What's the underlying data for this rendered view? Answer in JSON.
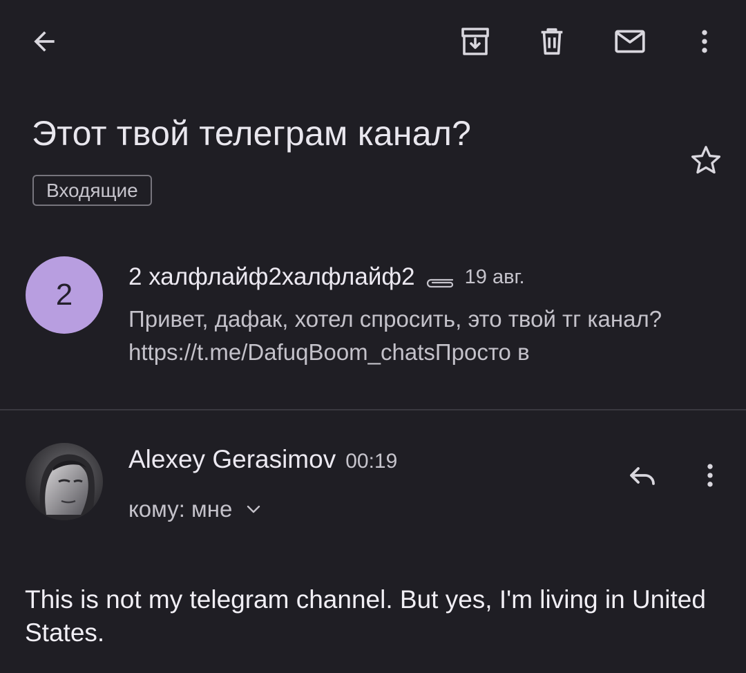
{
  "toolbar": {
    "back": "back-arrow-icon",
    "archive": "archive-icon",
    "delete": "trash-icon",
    "mark_unread": "mail-icon",
    "more": "more-vert-icon"
  },
  "subject": "Этот твой телеграм канал?",
  "label": "Входящие",
  "colors": {
    "background": "#1f1e24",
    "avatar": "#b89ee0",
    "text": "#e6e4ea",
    "muted": "#c4c2ca"
  },
  "collapsed_message": {
    "avatar_letter": "2",
    "sender": "2 халфлайф2халфлайф2",
    "date": "19 авг.",
    "snippet": "Привет, дафак, хотел спросить, это твой тг канал? https://t.me/DafuqBoom_chatsПросто в",
    "attachment_icon": "paperclip-icon"
  },
  "expanded_message": {
    "sender": "Alexey Gerasimov",
    "time": "00:19",
    "recipients": "кому: мне",
    "body": "This is not my telegram channel. But yes, I'm living in United States."
  }
}
